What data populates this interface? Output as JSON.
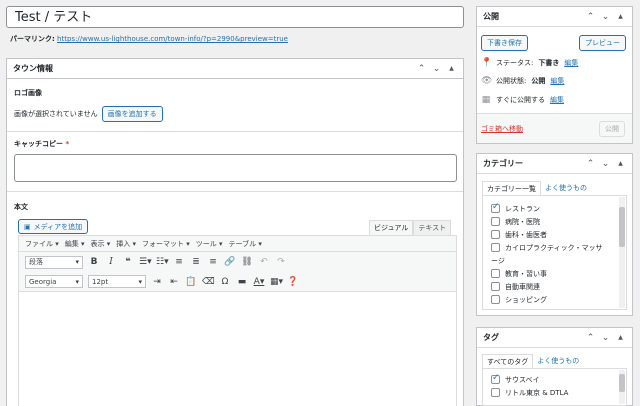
{
  "title_input": {
    "value": "Test / テスト"
  },
  "permalink": {
    "label": "パーマリンク:",
    "url": "https://www.us-lighthouse.com/town-info/?p=2990&preview=true"
  },
  "town_box": {
    "title": "タウン情報",
    "logo": {
      "label": "ロゴ画像",
      "none_text": "画像が選択されていません",
      "add_button": "画像を追加する"
    },
    "catch": {
      "label": "キャッチコピー",
      "required_mark": "*"
    },
    "body": {
      "label": "本文",
      "media_button": "メディアを追加",
      "tab_visual": "ビジュアル",
      "tab_text": "テキスト",
      "menus": [
        "ファイル",
        "編集",
        "表示",
        "挿入",
        "フォーマット",
        "ツール",
        "テーブル"
      ],
      "format_select": "段落",
      "font_select": "Georgia",
      "size_select": "12pt"
    }
  },
  "publish_box": {
    "title": "公開",
    "save_draft": "下書き保存",
    "preview": "プレビュー",
    "status_label": "ステータス:",
    "status_value": "下書き",
    "visibility_label": "公開状態:",
    "visibility_value": "公開",
    "schedule_text": "すぐに公開する",
    "edit": "編集",
    "trash": "ゴミ箱へ移動",
    "publish": "公開"
  },
  "category_box": {
    "title": "カテゴリー",
    "tab_all": "カテゴリー一覧",
    "tab_popular": "よく使うもの",
    "items": [
      {
        "label": "レストラン",
        "checked": true
      },
      {
        "label": "病院・医院",
        "checked": false
      },
      {
        "label": "歯科・歯医者",
        "checked": false
      },
      {
        "label": "カイロプラクティック・マッサ",
        "checked": false
      },
      {
        "label": "ージ",
        "checked": false,
        "cont": true
      },
      {
        "label": "教育・習い事",
        "checked": false
      },
      {
        "label": "自動車関連",
        "checked": false
      },
      {
        "label": "ショッピング",
        "checked": false
      }
    ]
  },
  "tag_box": {
    "title": "タグ",
    "tab_all": "すべてのタグ",
    "tab_popular": "よく使うもの",
    "items": [
      {
        "label": "サウスベイ",
        "checked": true
      },
      {
        "label": "リトル東京 & DTLA",
        "checked": false
      }
    ]
  }
}
